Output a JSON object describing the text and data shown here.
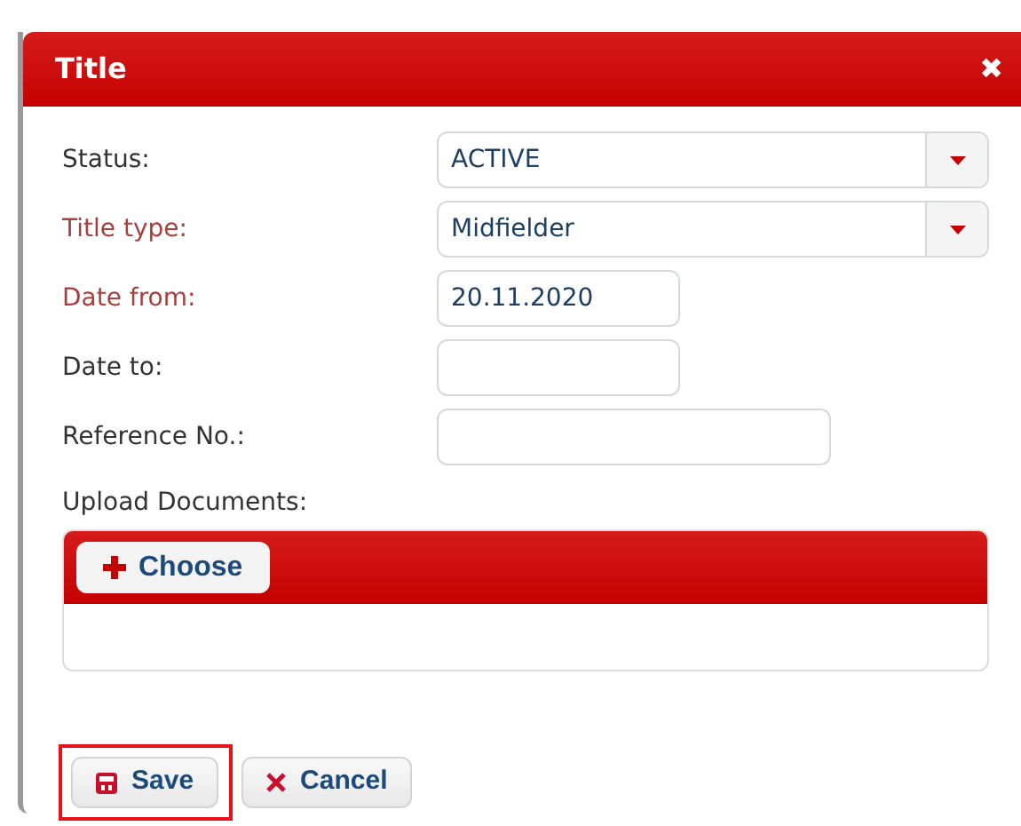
{
  "dialog": {
    "title": "Title",
    "close": "✖"
  },
  "fields": [
    {
      "label": "Status:",
      "required": false,
      "kind": "select",
      "value": "ACTIVE"
    },
    {
      "label": "Title type:",
      "required": true,
      "kind": "select",
      "value": "Midfielder"
    },
    {
      "label": "Date from:",
      "required": true,
      "kind": "date",
      "value": "20.11.2020"
    },
    {
      "label": "Date to:",
      "required": false,
      "kind": "date"
    },
    {
      "label": "Reference No.:",
      "required": false,
      "kind": "text"
    }
  ],
  "upload": {
    "label": "Upload Documents:",
    "button": "Choose"
  },
  "buttons": [
    {
      "label": "Save",
      "kind": "save",
      "highlighted": true
    },
    {
      "label": "Cancel",
      "kind": "cancel",
      "highlighted": false
    }
  ]
}
